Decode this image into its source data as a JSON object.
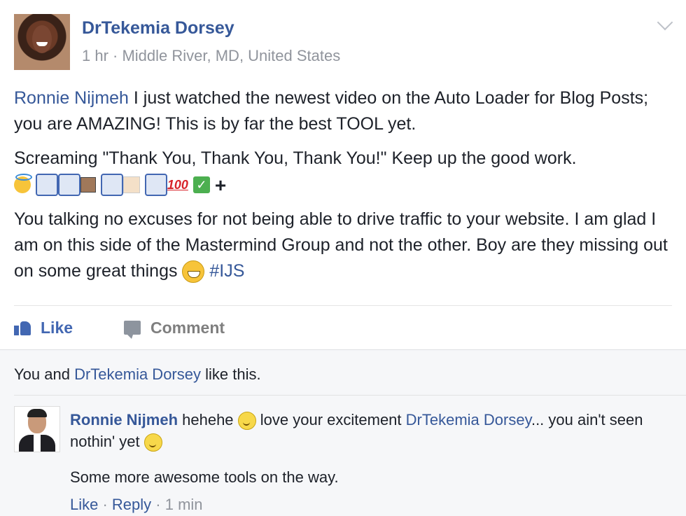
{
  "post": {
    "author": "DrTekemia Dorsey",
    "meta": "1 hr · Middle River, MD, United States",
    "mention": "Ronnie Nijmeh",
    "para1": " I just watched the newest video on the Auto Loader for Blog Posts; you are AMAZING! This is by far the best TOOL yet.",
    "para2": "Screaming \"Thank You, Thank You, Thank You!\" Keep up the good work.",
    "emoji_100": "100",
    "emoji_check": "✓",
    "emoji_plus": "+",
    "para3": "You talking no excuses for not being able to drive traffic to your website. I am glad I am on this side of the Mastermind Group and not the other. Boy are they missing out on some great things ",
    "hashtag": "#IJS"
  },
  "actions": {
    "like": "Like",
    "comment": "Comment"
  },
  "likes_summary": {
    "prefix": "You and ",
    "name": "DrTekemia Dorsey",
    "suffix": " like this."
  },
  "comment": {
    "author": "Ronnie Nijmeh",
    "text1": " hehehe ",
    "text2": " love your excitement ",
    "mention": "DrTekemia Dorsey",
    "text3": "... you ain't seen nothin' yet ",
    "extra": "Some more awesome tools on the way.",
    "like": "Like",
    "dot1": " · ",
    "reply": "Reply",
    "dot2": " · ",
    "time": "1 min"
  },
  "colors": {
    "link": "#365899",
    "like_blue": "#4267b2",
    "meta_gray": "#90949c"
  }
}
